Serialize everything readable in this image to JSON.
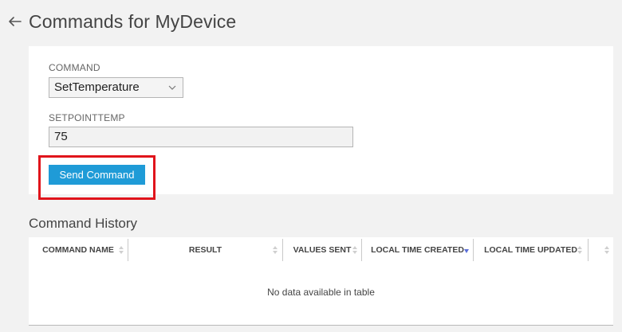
{
  "header": {
    "title": "Commands for MyDevice"
  },
  "command_form": {
    "command_label": "COMMAND",
    "command_selected": "SetTemperature",
    "param_label": "SETPOINTTEMP",
    "param_value": "75",
    "send_label": "Send Command",
    "send_color": "#1f9bd7",
    "highlight_color": "#e0141b"
  },
  "history": {
    "title": "Command History",
    "columns": [
      "COMMAND NAME",
      "RESULT",
      "VALUES SENT",
      "LOCAL TIME CREATED",
      "LOCAL TIME UPDATED"
    ],
    "sorted_column": "LOCAL TIME CREATED",
    "sort_direction": "descending",
    "empty_message": "No data available in table"
  }
}
